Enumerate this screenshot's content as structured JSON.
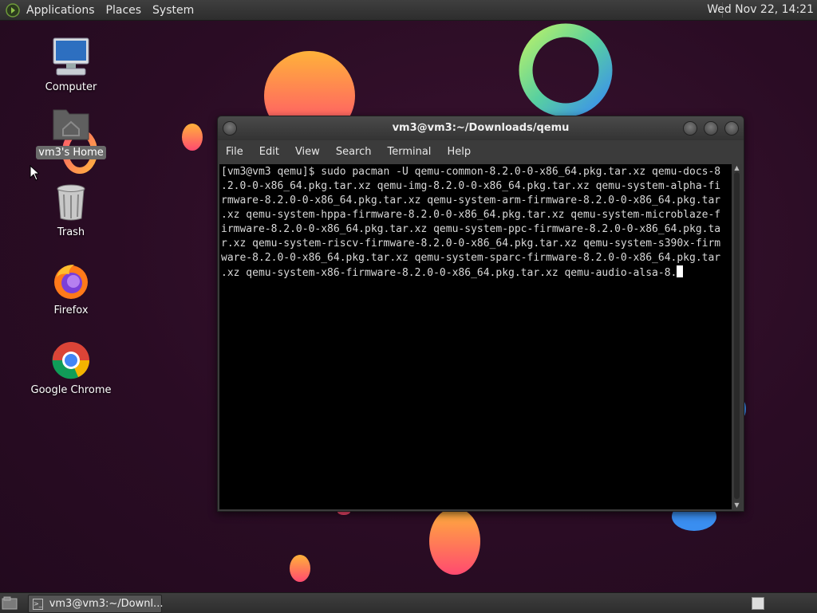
{
  "top_panel": {
    "menus": [
      "Applications",
      "Places",
      "System"
    ],
    "clock": "Wed Nov 22, 14:21"
  },
  "desktop_icons": [
    {
      "label": "Computer",
      "icon": "computer-icon"
    },
    {
      "label": "vm3's Home",
      "icon": "home-folder-icon",
      "selected": true
    },
    {
      "label": "Trash",
      "icon": "trash-icon"
    },
    {
      "label": "Firefox",
      "icon": "firefox-icon"
    },
    {
      "label": "Google Chrome",
      "icon": "chrome-icon"
    }
  ],
  "terminal": {
    "title": "vm3@vm3:~/Downloads/qemu",
    "menu": [
      "File",
      "Edit",
      "View",
      "Search",
      "Terminal",
      "Help"
    ],
    "lines": [
      "[vm3@vm3 qemu]$ sudo pacman -U qemu-common-8.2.0-0-x86_64.pkg.tar.xz qemu-docs-8",
      ".2.0-0-x86_64.pkg.tar.xz qemu-img-8.2.0-0-x86_64.pkg.tar.xz qemu-system-alpha-fi",
      "rmware-8.2.0-0-x86_64.pkg.tar.xz qemu-system-arm-firmware-8.2.0-0-x86_64.pkg.tar",
      ".xz qemu-system-hppa-firmware-8.2.0-0-x86_64.pkg.tar.xz qemu-system-microblaze-f",
      "irmware-8.2.0-0-x86_64.pkg.tar.xz qemu-system-ppc-firmware-8.2.0-0-x86_64.pkg.ta",
      "r.xz qemu-system-riscv-firmware-8.2.0-0-x86_64.pkg.tar.xz qemu-system-s390x-firm",
      "ware-8.2.0-0-x86_64.pkg.tar.xz qemu-system-sparc-firmware-8.2.0-0-x86_64.pkg.tar",
      ".xz qemu-system-x86-firmware-8.2.0-0-x86_64.pkg.tar.xz qemu-audio-alsa-8."
    ]
  },
  "taskbar": {
    "tasks": [
      {
        "label": "vm3@vm3:~/Downl...",
        "icon": "terminal-icon"
      }
    ]
  },
  "colors": {
    "wallpaper": "#2a0c24",
    "panel": "#353535",
    "terminal_bg": "#000000",
    "terminal_fg": "#d9d9d9"
  }
}
